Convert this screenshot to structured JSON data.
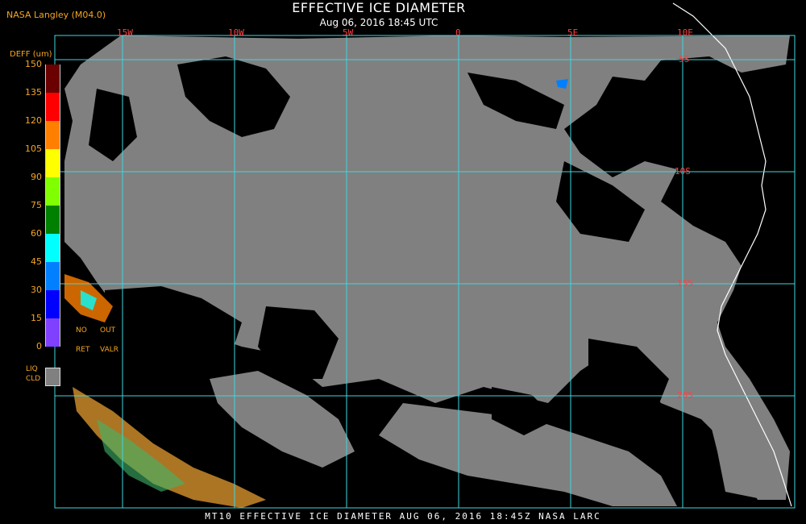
{
  "header": {
    "source": "NASA Langley (M04.0)",
    "title": "EFFECTIVE ICE DIAMETER",
    "subtitle": "Aug 06, 2016 18:45 UTC"
  },
  "map": {
    "lon_labels": [
      "15W",
      "10W",
      "5W",
      "0",
      "5E",
      "10E"
    ],
    "lat_labels": [
      "5S",
      "10S",
      "15S",
      "20S"
    ],
    "colors": {
      "clear": "#000000",
      "liquid_cloud": "#808080",
      "grid": "#3fd6e0",
      "coast": "#ffffff",
      "grid_label": "#ff4040"
    }
  },
  "legend": {
    "title": "DEFF (um)",
    "ticks": [
      "150",
      "135",
      "120",
      "105",
      "90",
      "75",
      "60",
      "45",
      "30",
      "15",
      "0"
    ],
    "colors": [
      "#6b0000",
      "#ff0000",
      "#ff8000",
      "#ffff00",
      "#80ff00",
      "#008000",
      "#00ffff",
      "#0080ff",
      "#0000ff",
      "#8040ff"
    ],
    "no_ret": [
      "NO",
      "RET"
    ],
    "out_valr": [
      "OUT",
      "VALR"
    ],
    "liq_cld": [
      "LIQ",
      "CLD"
    ]
  },
  "footer": "MT10  EFFECTIVE ICE DIAMETER  AUG 06, 2016 18:45Z  NASA LARC"
}
